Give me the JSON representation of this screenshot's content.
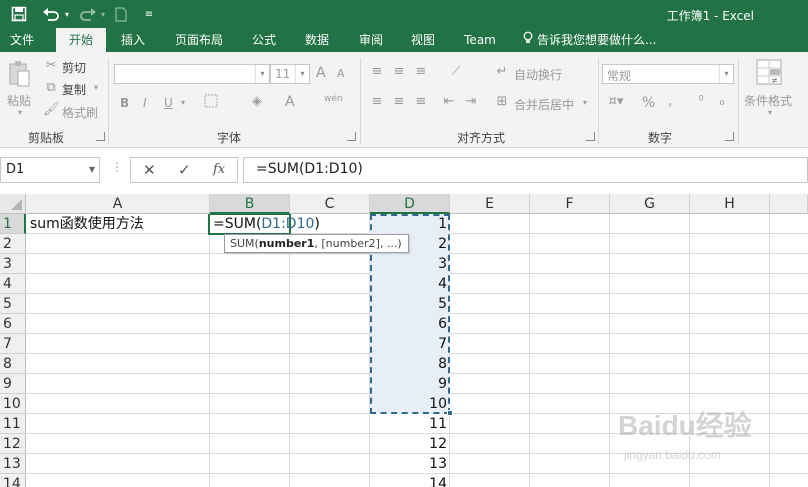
{
  "window": {
    "title": "工作簿1 - Excel",
    "accent": "#217346"
  },
  "qat": {
    "save_icon": "save-icon",
    "undo_icon": "undo-icon",
    "redo_icon": "redo-icon",
    "new_icon": "new-file-icon",
    "customize_icon": "customize-qat-icon"
  },
  "tabs": [
    {
      "label": "文件"
    },
    {
      "label": "开始"
    },
    {
      "label": "插入"
    },
    {
      "label": "页面布局"
    },
    {
      "label": "公式"
    },
    {
      "label": "数据"
    },
    {
      "label": "审阅"
    },
    {
      "label": "视图"
    },
    {
      "label": "Team"
    }
  ],
  "active_tab": "开始",
  "tell_me": "告诉我您想要做什么...",
  "ribbon": {
    "clipboard": {
      "label": "剪贴板",
      "paste": "粘贴",
      "cut": "剪切",
      "copy": "复制",
      "format_painter": "格式刷"
    },
    "font": {
      "label": "字体",
      "font_name": "",
      "font_size": "11",
      "bold": "B",
      "italic": "I",
      "underline": "U",
      "grow": "A",
      "shrink": "A",
      "font_color": "A",
      "phonetic": "wén"
    },
    "alignment": {
      "label": "对齐方式",
      "wrap_text": "自动换行",
      "merge_center": "合并后居中"
    },
    "number": {
      "label": "数字",
      "format": "常规",
      "percent": "%",
      "comma": ","
    },
    "styles": {
      "conditional": "条件格式"
    }
  },
  "formula_bar": {
    "name_box": "D1",
    "cancel": "✕",
    "enter": "✓",
    "fx": "fx",
    "formula": "=SUM(D1:D10)"
  },
  "grid": {
    "columns": [
      "A",
      "B",
      "C",
      "D",
      "E",
      "F",
      "G",
      "H"
    ],
    "rows": [
      "1",
      "2",
      "3",
      "4",
      "5",
      "6",
      "7",
      "8",
      "9",
      "10",
      "11",
      "12",
      "13",
      "14"
    ],
    "a1": "sum函数使用方法",
    "b1_prefix": "=SUM(",
    "b1_ref": "D1:D10",
    "b1_suffix": ")",
    "tooltip_prefix": "SUM(",
    "tooltip_bold": "number1",
    "tooltip_suffix": ", [number2], ...)",
    "d_values": [
      "1",
      "2",
      "3",
      "4",
      "5",
      "6",
      "7",
      "8",
      "9",
      "10",
      "11",
      "12",
      "13",
      "14"
    ]
  },
  "watermark": {
    "brand": "Baidu经验",
    "url": "jingyan.baidu.com"
  }
}
